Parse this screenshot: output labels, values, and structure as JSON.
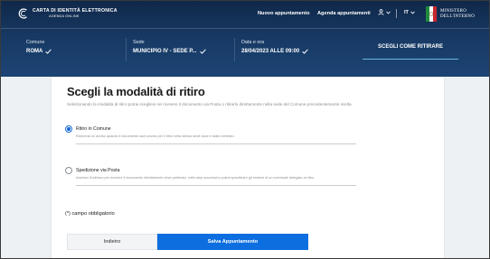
{
  "header": {
    "app_title": "CARTA DI IDENTITÀ ELETTRONICA",
    "app_subtitle": "AGENDA ONLINE",
    "nav": {
      "new_appointment": "Nuovo appuntamento",
      "appointments_agenda": "Agenda appuntamenti"
    },
    "language": "IT",
    "ministry": {
      "line1": "MINISTERO",
      "line2": "DELL'INTERNO"
    }
  },
  "steps": [
    {
      "label": "Comune",
      "value": "ROMA"
    },
    {
      "label": "Sede",
      "value": "MUNICIPIO IV - SEDE P..."
    },
    {
      "label": "Data e ora",
      "value": "28/04/2023 ALLE 09:00"
    }
  ],
  "current_step": "SCEGLI COME RITIRARE",
  "colors": {
    "header_bg": "#183b66",
    "primary": "#0d6ee0",
    "active_underline": "#6fb6e6"
  },
  "card": {
    "title": "Scegli la modalità di ritiro",
    "description": "Selezionando la modalità di ritiro potrai scegliere se ricevere il documento via Posta o ritirarlo direttamente nella sede del Comune precedentemente scelta.",
    "options": [
      {
        "label": "Ritiro in Comune",
        "help": "Riceverai un avviso quando il documento sarà pronto per il ritiro nella stessa sede dove è stato richiesto.",
        "selected": true
      },
      {
        "label": "Spedizione via Posta",
        "help": "Inserisci l'indirizzo per ricevere il documento direttamente dove preferisci. nello step successivo potrai specificare gli estremi di un eventuale delegato al ritiro",
        "selected": false
      }
    ],
    "required_note": "(*) campo obbligatorio",
    "back_button": "Indietro",
    "save_button": "Salva Appuntamento"
  }
}
